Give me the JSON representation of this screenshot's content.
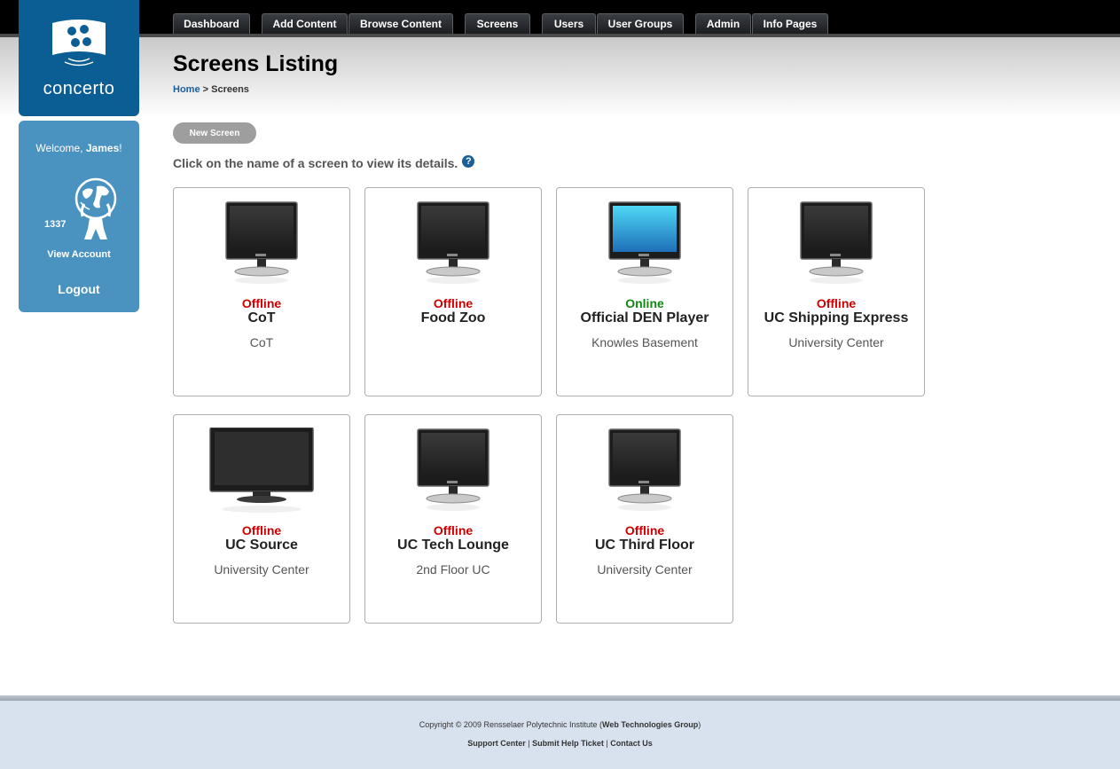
{
  "nav": {
    "tabs": [
      {
        "label": "Dashboard"
      },
      {
        "label": "Add Content"
      },
      {
        "label": "Browse Content"
      },
      {
        "label": "Screens"
      },
      {
        "label": "Users"
      },
      {
        "label": "User Groups"
      },
      {
        "label": "Admin"
      },
      {
        "label": "Info Pages"
      }
    ]
  },
  "sidebar": {
    "logo_text": "concerto",
    "welcome_prefix": "Welcome, ",
    "user_name": "James",
    "welcome_suffix": "!",
    "points": "1337",
    "view_account": "View Account",
    "logout": "Logout"
  },
  "header": {
    "title": "Screens Listing",
    "breadcrumb_home": "Home",
    "breadcrumb_sep": " > ",
    "breadcrumb_current": "Screens"
  },
  "main": {
    "new_screen_label": "New Screen",
    "instructions": "Click on the name of a screen to view its details.",
    "help_glyph": "?"
  },
  "screens": [
    {
      "status": "Offline",
      "name": "CoT",
      "location": "CoT",
      "monitor": "lcd-off"
    },
    {
      "status": "Offline",
      "name": "Food Zoo",
      "location": "",
      "monitor": "lcd-off"
    },
    {
      "status": "Online",
      "name": "Official DEN Player",
      "location": "Knowles Basement",
      "monitor": "lcd-on"
    },
    {
      "status": "Offline",
      "name": "UC Shipping Express",
      "location": "University Center",
      "monitor": "lcd-off"
    },
    {
      "status": "Offline",
      "name": "UC Source",
      "location": "University Center",
      "monitor": "widescreen-off"
    },
    {
      "status": "Offline",
      "name": "UC Tech Lounge",
      "location": "2nd Floor UC",
      "monitor": "lcd-off"
    },
    {
      "status": "Offline",
      "name": "UC Third Floor",
      "location": "University Center",
      "monitor": "lcd-off"
    }
  ],
  "footer": {
    "copyright_prefix": "Copyright © 2009 Rensselaer Polytechnic Institute (",
    "copyright_group": "Web Technologies Group",
    "copyright_suffix": ")",
    "links": [
      "Support Center",
      "Submit Help Ticket",
      "Contact Us"
    ],
    "separator": " | "
  },
  "colors": {
    "offline": "#cc0000",
    "online": "#118811",
    "sidebar_dark": "#0b5e93",
    "sidebar_light": "#4a93c0"
  }
}
